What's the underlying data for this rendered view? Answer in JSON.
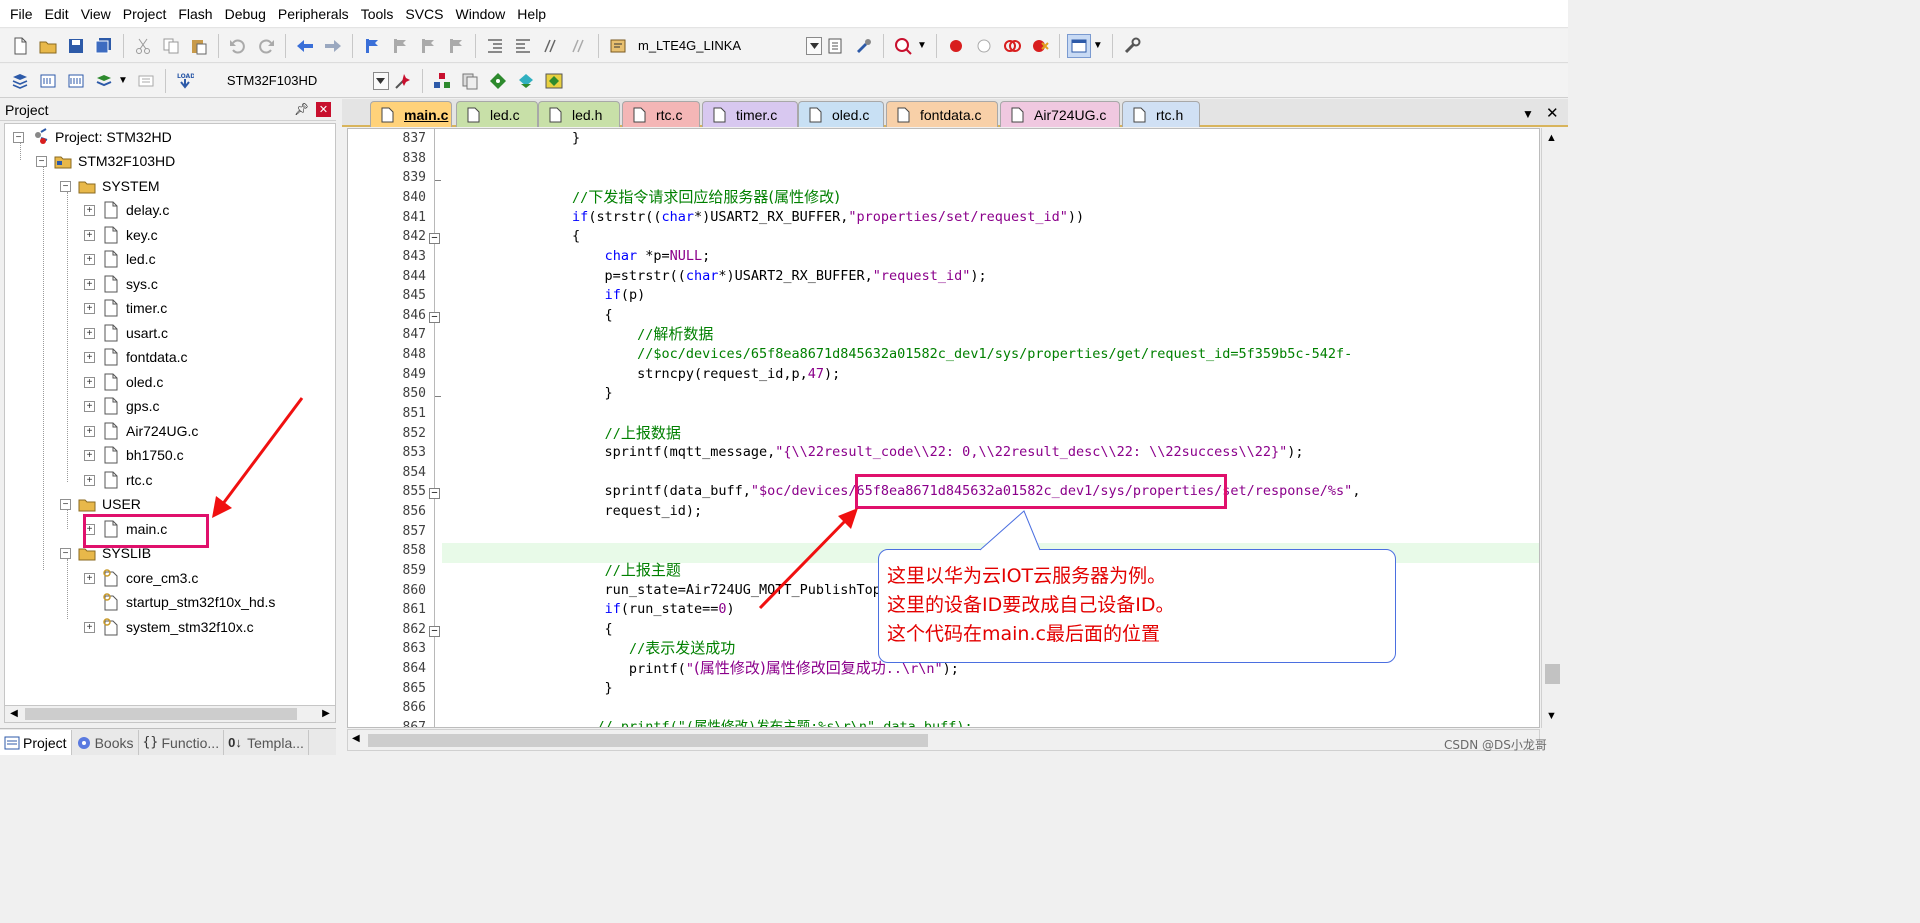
{
  "menu": [
    "File",
    "Edit",
    "View",
    "Project",
    "Flash",
    "Debug",
    "Peripherals",
    "Tools",
    "SVCS",
    "Window",
    "Help"
  ],
  "toolbar": {
    "target_combo": "m_LTE4G_LINKA",
    "device_combo": "STM32F103HD"
  },
  "project_panel": {
    "title": "Project",
    "root": "Project: STM32HD",
    "target": "STM32F103HD",
    "groups": [
      {
        "name": "SYSTEM",
        "files": [
          "delay.c",
          "key.c",
          "led.c",
          "sys.c",
          "timer.c",
          "usart.c",
          "fontdata.c",
          "oled.c",
          "gps.c",
          "Air724UG.c",
          "bh1750.c",
          "rtc.c"
        ]
      },
      {
        "name": "USER",
        "files": [
          "main.c"
        ]
      },
      {
        "name": "SYSLIB",
        "files": [
          "core_cm3.c",
          "startup_stm32f10x_hd.s",
          "system_stm32f10x.c"
        ]
      }
    ]
  },
  "bottom_tabs": [
    "Project",
    "Books",
    "Functio...",
    "Templa..."
  ],
  "editor_tabs": [
    {
      "label": "main.c",
      "color": "#ffd27a"
    },
    {
      "label": "led.c",
      "color": "#c8e0a8"
    },
    {
      "label": "led.h",
      "color": "#c8e0a8"
    },
    {
      "label": "rtc.c",
      "color": "#f4b6b6"
    },
    {
      "label": "timer.c",
      "color": "#d8c8f0"
    },
    {
      "label": "oled.c",
      "color": "#c8e0f4"
    },
    {
      "label": "fontdata.c",
      "color": "#f8d0a8"
    },
    {
      "label": "Air724UG.c",
      "color": "#f0c8e0"
    },
    {
      "label": "rtc.h",
      "color": "#d0e0f4"
    }
  ],
  "code": {
    "line_numbers": [
      "837",
      "838",
      "839",
      "840",
      "841",
      "842",
      "843",
      "844",
      "845",
      "846",
      "847",
      "848",
      "849",
      "850",
      "851",
      "852",
      "853",
      "854",
      "855",
      "856",
      "857",
      "858",
      "859",
      "860",
      "861",
      "862",
      "863",
      "864",
      "865",
      "866",
      "867"
    ]
  },
  "annotation": {
    "lines": [
      "这里以华为云IOT云服务器为例。",
      "这里的设备ID要改成自己设备ID。",
      "这个代码在main.c最后面的位置"
    ]
  },
  "watermark": "CSDN @DS小龙哥"
}
